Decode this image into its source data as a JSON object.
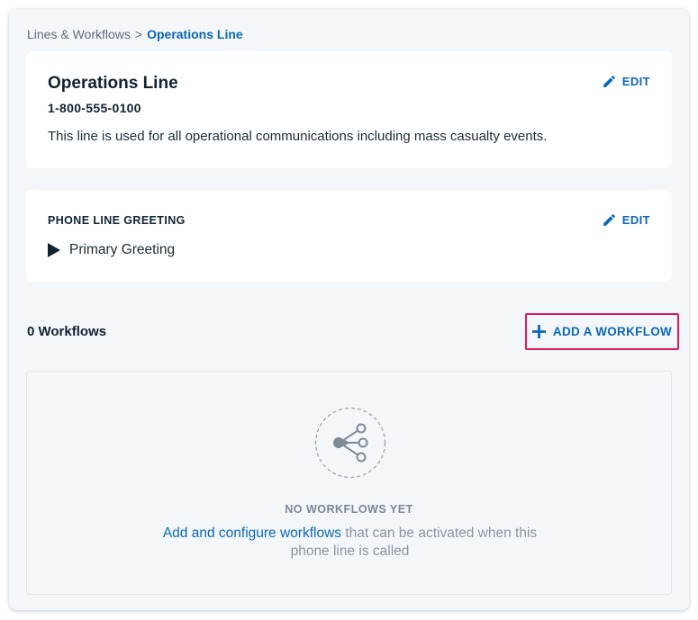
{
  "breadcrumb": {
    "parent": "Lines & Workflows",
    "separator": ">",
    "current": "Operations Line"
  },
  "line_card": {
    "title": "Operations Line",
    "phone": "1-800-555-0100",
    "description": "This line is used for all operational communications including mass casualty events.",
    "edit_label": "EDIT"
  },
  "greeting_card": {
    "label": "PHONE LINE GREETING",
    "greeting_name": "Primary Greeting",
    "edit_label": "EDIT"
  },
  "workflows": {
    "count_label": "0 Workflows",
    "add_label": "ADD A WORKFLOW",
    "empty_title": "NO WORKFLOWS YET",
    "empty_link": "Add and configure workflows",
    "empty_rest": " that can be activated when this phone line is called"
  },
  "colors": {
    "accent": "#0b67b8",
    "highlight": "#e0185f",
    "panel_bg": "#f4f7fa"
  },
  "icons": {
    "edit": "pencil-icon",
    "play": "play-icon",
    "add": "plus-icon",
    "empty": "workflow-share-icon"
  }
}
